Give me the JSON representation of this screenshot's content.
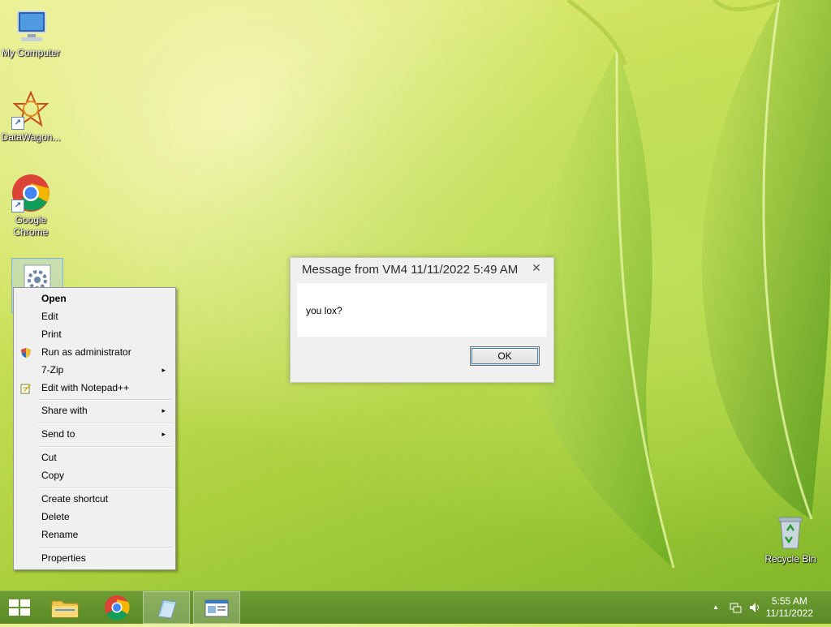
{
  "desktop_icons": [
    {
      "name": "My Computer",
      "icon": "my-computer-icon"
    },
    {
      "name": "DataWagon...",
      "icon": "datawagon-icon"
    },
    {
      "name": "Google Chrome",
      "icon": "chrome-icon"
    },
    {
      "name": "",
      "icon": "settings-file-icon"
    },
    {
      "name": "Recycle Bin",
      "icon": "recycle-bin-icon"
    }
  ],
  "context_menu": {
    "items": [
      {
        "label": "Open"
      },
      {
        "label": "Edit"
      },
      {
        "label": "Print"
      },
      {
        "label": "Run as administrator",
        "icon": "uac-shield-icon"
      },
      {
        "label": "7-Zip"
      },
      {
        "label": "Edit with Notepad++",
        "icon": "notepad-plus-icon"
      },
      {
        "label": "Share with"
      },
      {
        "label": "Send to"
      },
      {
        "label": "Cut"
      },
      {
        "label": "Copy"
      },
      {
        "label": "Create shortcut"
      },
      {
        "label": "Delete"
      },
      {
        "label": "Rename"
      },
      {
        "label": "Properties"
      }
    ],
    "submenu_arrow": "▸"
  },
  "message_box": {
    "title": "Message from VM4 11/11/2022 5:49 AM",
    "close_glyph": "✕",
    "message": "you lox?",
    "ok_label": "OK"
  },
  "taskbar": {
    "tray_arrow": "▲",
    "time": "5:55 AM",
    "date": "11/11/2022"
  },
  "colors": {
    "taskbar": "#5f8e2a",
    "menu_bg": "#f0f0f0",
    "accent_blue": "#3c7fb1"
  }
}
